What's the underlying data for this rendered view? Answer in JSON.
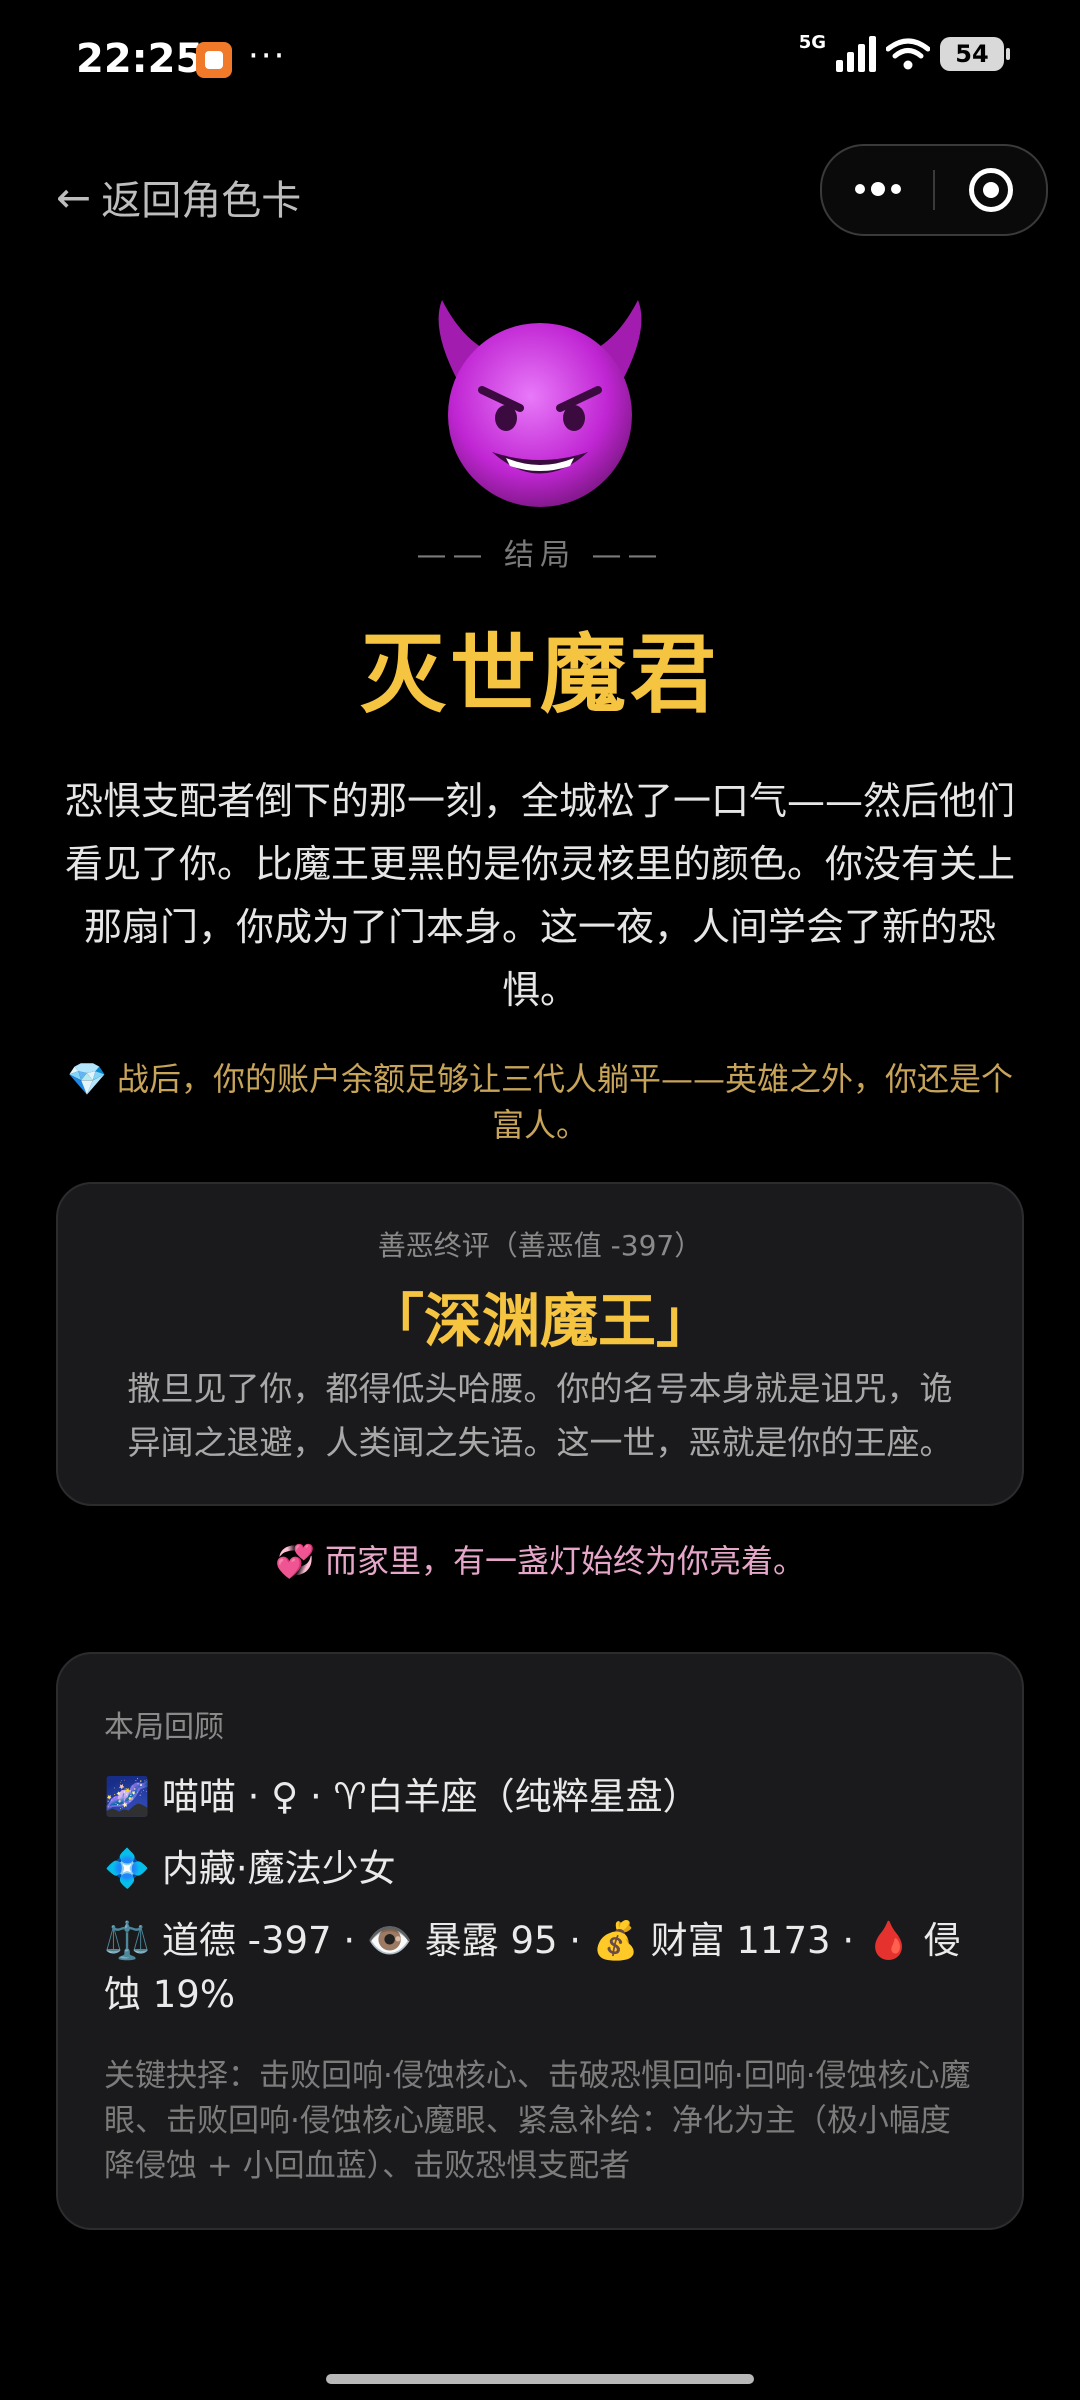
{
  "status": {
    "time": "22:25",
    "dots": "···",
    "signal": "5G",
    "battery": "54"
  },
  "nav": {
    "back_label": "返回角色卡"
  },
  "ending": {
    "label": "—— 结局 ——",
    "title": "灭世魔君",
    "description": "恐惧支配者倒下的那一刻，全城松了一口气——然后他们看见了你。比魔王更黑的是你灵核里的颜色。你没有关上那扇门，你成为了门本身。这一夜，人间学会了新的恐惧。",
    "wealth_note": "💎 战后，你的账户余额足够让三代人躺平——英雄之外，你还是个富人。"
  },
  "verdict": {
    "subtitle": "善恶终评（善恶值 -397）",
    "title": "「深渊魔王」",
    "description": "撒旦见了你，都得低头哈腰。你的名号本身就是诅咒，诡异闻之退避，人类闻之失语。这一世，恶就是你的王座。"
  },
  "home_note": "💞 而家里，有一盏灯始终为你亮着。",
  "recap": {
    "heading": "本局回顾",
    "line1": "🌌 喵喵 · ♀ · ♈白羊座（纯粹星盘）",
    "line2": "💠 内藏·魔法少女",
    "line3": "⚖️ 道德 -397 · 👁️ 暴露 95 · 💰 财富 1173 · 🩸 侵蚀 19%",
    "choices": "关键抉择：击败回响·侵蚀核心、击破恐惧回响·回响·侵蚀核心魔眼、击败回响·侵蚀核心魔眼、紧急补给：净化为主（极小幅度降侵蚀 + 小回血蓝）、击败恐惧支配者"
  },
  "colors": {
    "accent_gold": "#f5c542",
    "devil_purple": "#c026d3",
    "wealth_gold": "#c7a45a",
    "home_pink": "#e6a6c9"
  },
  "icons": [
    "back-arrow-icon",
    "more-icon",
    "close-target-icon",
    "devil-emoji-icon"
  ]
}
